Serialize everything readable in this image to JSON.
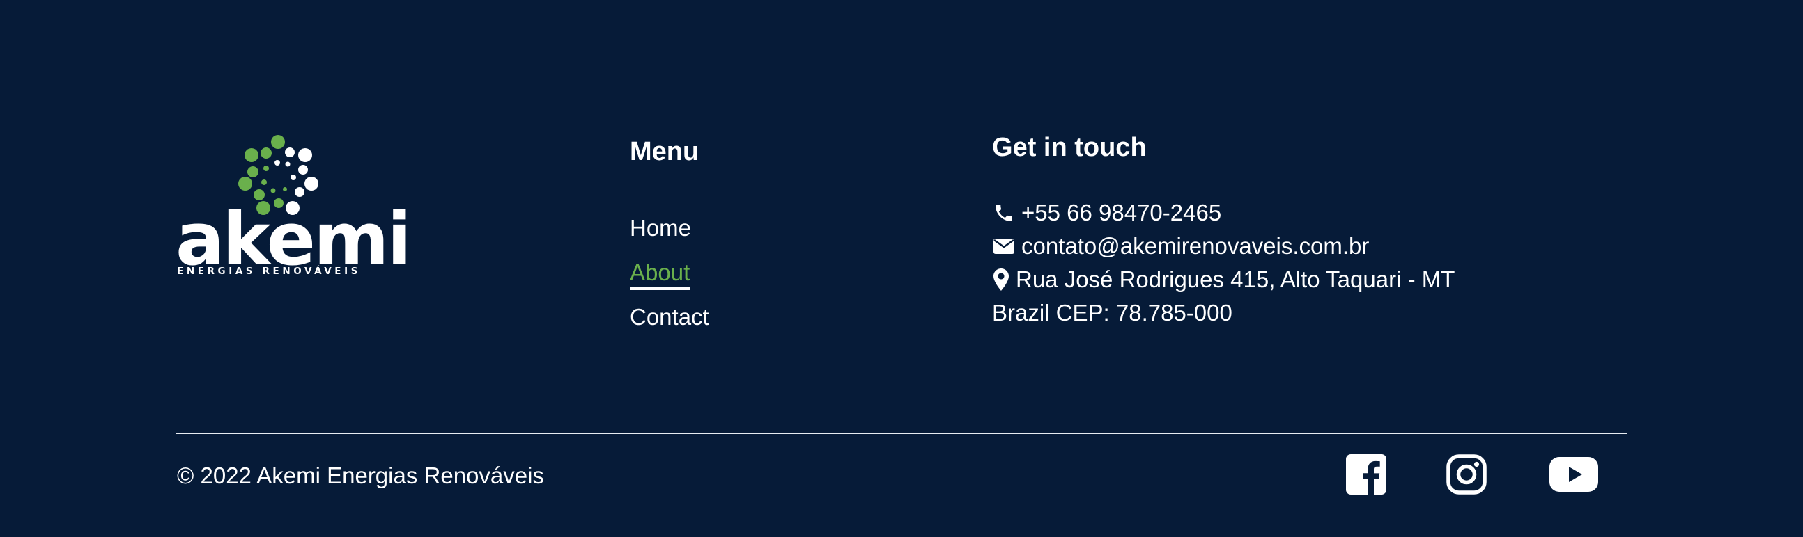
{
  "brand": {
    "wordmark": "akemi",
    "tagline": "ENERGIAS RENOVÁVEIS",
    "colors": {
      "background": "#061b38",
      "accent": "#6ab04c",
      "text": "#ffffff"
    }
  },
  "menu": {
    "heading": "Menu",
    "items": [
      {
        "label": "Home",
        "active": false
      },
      {
        "label": "About",
        "active": true
      },
      {
        "label": "Contact",
        "active": false
      }
    ]
  },
  "contact": {
    "heading": "Get in touch",
    "phone": "+55 66 98470-2465",
    "email": "contato@akemirenovaveis.com.br",
    "address_line1": "Rua José Rodrigues 415, Alto Taquari - MT",
    "address_line2": "Brazil CEP: 78.785-000",
    "icons": {
      "phone": "phone-icon",
      "email": "envelope-icon",
      "address": "map-pin-icon"
    }
  },
  "footer": {
    "copyright": "© 2022 Akemi Energias Renováveis",
    "social": [
      {
        "name": "facebook-icon"
      },
      {
        "name": "instagram-icon"
      },
      {
        "name": "youtube-icon"
      }
    ]
  }
}
